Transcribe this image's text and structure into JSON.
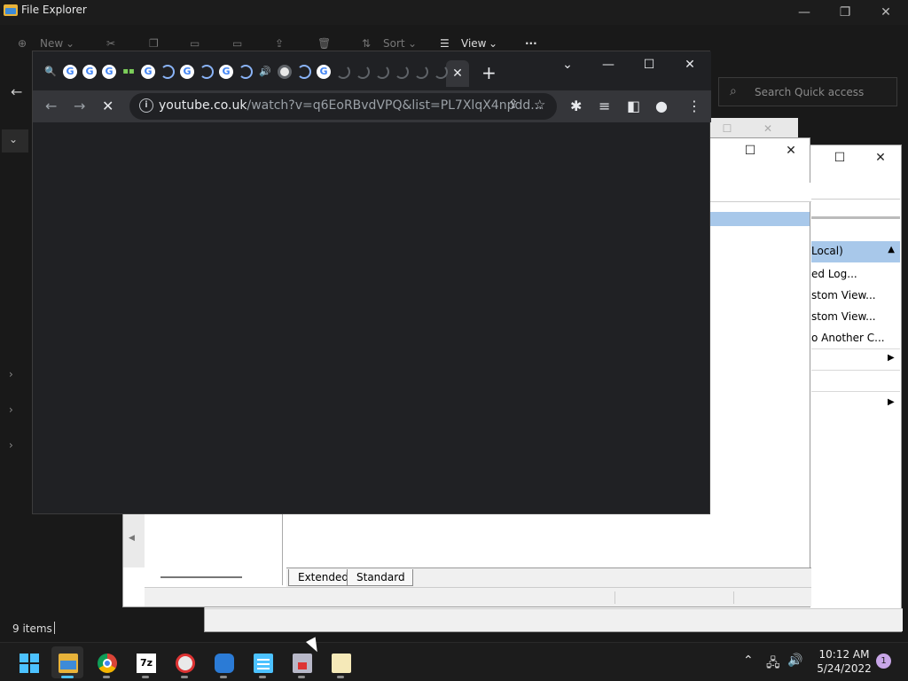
{
  "explorer": {
    "title": "File Explorer",
    "toolbar": {
      "new_label": "New",
      "sort_label": "Sort",
      "view_label": "View",
      "more_label": "···"
    },
    "search_placeholder": "Search Quick access",
    "status_items": "9 items",
    "caption": {
      "minimize": "—",
      "maximize": "❐",
      "close": "✕"
    }
  },
  "event_viewer": {
    "actions_header": "Local)",
    "actions": [
      "ed Log...",
      "stom View...",
      "stom View...",
      "o Another C..."
    ],
    "tabs": [
      "Extended",
      "Standard"
    ],
    "caption": {
      "maximize": "☐",
      "close": "✕"
    }
  },
  "chrome": {
    "url_host": "youtube.co.uk",
    "url_rest": "/watch?v=q6EoRBvdVPQ&list=PL7XlqX4npdd...",
    "tab_close": "✕",
    "new_tab": "+",
    "caption": {
      "dropdown": "⌄",
      "minimize": "—",
      "maximize": "☐",
      "close": "✕"
    },
    "tabs": [
      {
        "kind": "sch",
        "glyph": "🔍"
      },
      {
        "kind": "g",
        "glyph": "G"
      },
      {
        "kind": "g",
        "glyph": "G"
      },
      {
        "kind": "g",
        "glyph": "G"
      },
      {
        "kind": "grn",
        "glyph": "▪▪"
      },
      {
        "kind": "g",
        "glyph": "G"
      },
      {
        "kind": "spin",
        "glyph": ""
      },
      {
        "kind": "g",
        "glyph": "G"
      },
      {
        "kind": "spin",
        "glyph": ""
      },
      {
        "kind": "g",
        "glyph": "G"
      },
      {
        "kind": "spin",
        "glyph": ""
      },
      {
        "kind": "snd",
        "glyph": "🔊"
      },
      {
        "kind": "ring",
        "glyph": ""
      },
      {
        "kind": "spin",
        "glyph": ""
      },
      {
        "kind": "g",
        "glyph": "G"
      },
      {
        "kind": "dim",
        "glyph": ""
      },
      {
        "kind": "dim",
        "glyph": ""
      },
      {
        "kind": "dim",
        "glyph": ""
      },
      {
        "kind": "dim",
        "glyph": ""
      },
      {
        "kind": "dim",
        "glyph": ""
      },
      {
        "kind": "dim",
        "glyph": ""
      }
    ]
  },
  "taskbar": {
    "time": "10:12 AM",
    "date": "5/24/2022",
    "notification_count": "1",
    "apps": [
      "start",
      "file-explorer",
      "chrome",
      "7zip",
      "paint",
      "app-blue",
      "notepad",
      "app-doc",
      "notes"
    ]
  },
  "colors": {
    "accent": "#4cc2ff",
    "selection": "#a8c8ea",
    "chrome_bg": "#202124"
  }
}
